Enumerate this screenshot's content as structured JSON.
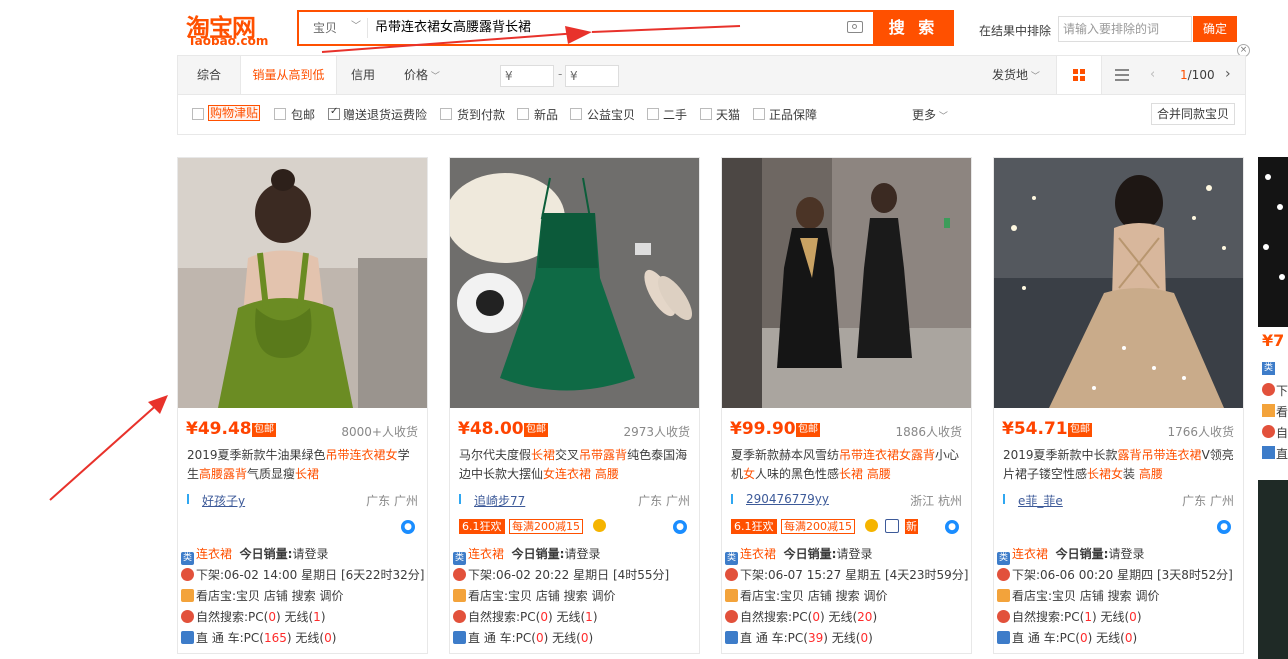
{
  "header": {
    "logo_cn": "淘宝网",
    "logo_en": "Taobao.com",
    "search": {
      "category": "宝贝",
      "query": "吊带连衣裙女高腰露背长裙",
      "button": "搜 索"
    },
    "exclude": {
      "label": "在结果中排除",
      "placeholder": "请输入要排除的词",
      "button": "确定"
    },
    "close": "×"
  },
  "sortbar": {
    "items": [
      "综合",
      "销量从高到低",
      "信用",
      "价格"
    ],
    "price_from": "¥",
    "price_to": "¥",
    "price_sep": "-",
    "ship_from": "发货地",
    "page": "1",
    "page_total": "/100"
  },
  "filters": {
    "items": [
      "购物津贴",
      "包邮",
      "赠送退货运费险",
      "货到付款",
      "新品",
      "公益宝贝",
      "二手",
      "天猫",
      "正品保障"
    ],
    "more": "更多",
    "merge": "合并同款宝贝"
  },
  "products": [
    {
      "price": "¥49.48",
      "baoyou": "包邮",
      "sales": "8000+人收货",
      "title": [
        "2019夏季新款牛油果绿色",
        "吊带连衣裙女",
        "学生",
        "高腰露背",
        "气质显瘦",
        "长裙"
      ],
      "shop": "好孩子y",
      "location": "广东 广州",
      "badges": [],
      "category": "连衣裙",
      "today_sales_label": "今日销量:",
      "today_sales_value": "请登录",
      "listed": "下架:06-02 14:00 星期日 [6天22时32分]",
      "view": "看店宝:宝贝 店铺 搜索 调价",
      "natural": [
        "自然搜索:PC(",
        "0",
        ") 无线(",
        "1",
        ")"
      ],
      "ztc": [
        "直 通 车:PC(",
        "165",
        ") 无线(",
        "0",
        ")"
      ]
    },
    {
      "price": "¥48.00",
      "baoyou": "包邮",
      "sales": "2973人收货",
      "title": [
        "马尔代夫度假",
        "长裙",
        "交叉",
        "吊带露背",
        "纯色泰国海边中长款大摆仙",
        "女连衣裙",
        " ",
        "高腰",
        ""
      ],
      "shop": "追崎步77",
      "location": "广东 广州",
      "badges": [
        "6.1狂欢",
        "每满200减15"
      ],
      "category": "连衣裙",
      "today_sales_label": "今日销量:",
      "today_sales_value": "请登录",
      "listed": "下架:06-02 20:22 星期日 [4时55分]",
      "view": "看店宝:宝贝 店铺 搜索 调价",
      "natural": [
        "自然搜索:PC(",
        "0",
        ") 无线(",
        "1",
        ")"
      ],
      "ztc": [
        "直 通 车:PC(",
        "0",
        ") 无线(",
        "0",
        ")"
      ]
    },
    {
      "price": "¥99.90",
      "baoyou": "包邮",
      "sales": "1886人收货",
      "title": [
        "夏季新款赫本风雪纺",
        "吊带连衣裙女露背",
        "小心机",
        "女",
        "人味的黑色性感",
        "长裙",
        " ",
        "高腰",
        ""
      ],
      "shop": "290476779yy",
      "location": "浙江 杭州",
      "badges": [
        "6.1狂欢",
        "每满200减15",
        "新"
      ],
      "category": "连衣裙",
      "today_sales_label": "今日销量:",
      "today_sales_value": "请登录",
      "listed": "下架:06-07 15:27 星期五 [4天23时59分]",
      "view": "看店宝:宝贝 店铺 搜索 调价",
      "natural": [
        "自然搜索:PC(",
        "0",
        ") 无线(",
        "20",
        ")"
      ],
      "ztc": [
        "直 通 车:PC(",
        "39",
        ") 无线(",
        "0",
        ")"
      ]
    },
    {
      "price": "¥54.71",
      "baoyou": "包邮",
      "sales": "1766人收货",
      "title": [
        "2019夏季新款中长款",
        "露背吊带连衣裙",
        "V领亮片裙子镂空性感",
        "长裙女",
        "装 ",
        "高腰",
        ""
      ],
      "shop": "e菲_菲e",
      "location": "广东 广州",
      "badges": [],
      "category": "连衣裙",
      "today_sales_label": "今日销量:",
      "today_sales_value": "请登录",
      "listed": "下架:06-06 00:20 星期四 [3天8时52分]",
      "view": "看店宝:宝贝 店铺 搜索 调价",
      "natural": [
        "自然搜索:PC(",
        "1",
        ") 无线(",
        "0",
        ")"
      ],
      "ztc": [
        "直 通 车:PC(",
        "0",
        ") 无线(",
        "0",
        ")"
      ]
    }
  ],
  "edge": {
    "price": "¥7",
    "labels": [
      "类",
      "下",
      "看",
      "自",
      "直"
    ]
  },
  "colors": {
    "accent": "#ff5000",
    "price": "#ff4400",
    "link": "#3d5a99",
    "annotation": "#e8322b"
  }
}
